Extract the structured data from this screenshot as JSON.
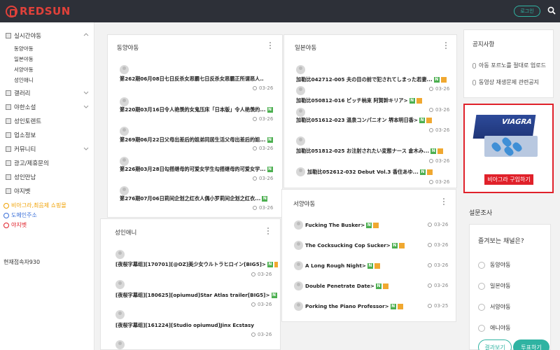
{
  "header": {
    "logo_text": "REDSUN",
    "login_label": "로그인",
    "accent": "#e0413a",
    "login_color": "#2fb3a2"
  },
  "sidebar": {
    "items": [
      {
        "label": "실시간야동",
        "expanded": true
      },
      {
        "label": "갤러리"
      },
      {
        "label": "야한소설"
      },
      {
        "label": "성인토렌트"
      },
      {
        "label": "업소정보"
      },
      {
        "label": "커뮤니티"
      },
      {
        "label": "광고/제휴문의"
      },
      {
        "label": "성인만남"
      },
      {
        "label": "야지벳"
      }
    ],
    "subitems": [
      "동양야동",
      "일본야동",
      "서양야동",
      "성인애니"
    ],
    "links": [
      {
        "label": "비아그라,최음제 쇼핑몰",
        "color": "#f0a000"
      },
      {
        "label": "도메인주소",
        "color": "#3a6fd8"
      },
      {
        "label": "야지벳",
        "color": "#e0212a"
      }
    ],
    "visitors": "현재접속자930"
  },
  "panels": {
    "dongyang": {
      "title": "동양야동",
      "posts": [
        {
          "title": "第262期06月08日七日反杀女恶霸七日反杀女恶霸正所谓恶人...",
          "date": "03-26",
          "n": false
        },
        {
          "title": "第220期03月16日令人艳羡的女鬼压床「日本版」令人艳羡的...",
          "date": "03-26",
          "n": true
        },
        {
          "title": "第269期06月22日父母出差后的姐弟同居生活父母出差后的姐...",
          "date": "03-26",
          "n": true
        },
        {
          "title": "第226期03月28日勾搭继母的可爱女学生勾搭继母的可爱女学...",
          "date": "03-26",
          "n": true
        },
        {
          "title": "第276期07月06日莉间企划之红衣人偶小罗莉间企划之红衣...",
          "date": "03-26",
          "n": true
        }
      ]
    },
    "ilbon": {
      "title": "일본야동",
      "posts": [
        {
          "title": "加勒比042712-005 夫の目の前で犯されてしまった若妻...",
          "date": "03-26"
        },
        {
          "title": "加勒比050812-016 ピッチ枘束 阿賀幹キリア>",
          "date": "03-26"
        },
        {
          "title": "加勒比051612-023 温泉コンパニオン 堺本明日香>",
          "date": "03-26"
        },
        {
          "title": "加勒比051812-025 お注射されたい変態ナース 倉木み...",
          "date": "03-26"
        },
        {
          "title": "加勒比052612-032 Debut Vol.3 香住あゆ...",
          "date": "03-26"
        }
      ]
    },
    "seoyang": {
      "title": "서양야동",
      "posts": [
        {
          "title": "Fucking The Busker>",
          "date": "03-26"
        },
        {
          "title": "The Cocksucking Cop Sucker>",
          "date": "03-26"
        },
        {
          "title": "A Long Rough Night>",
          "date": "03-26"
        },
        {
          "title": "Double Penetrate Date>",
          "date": "03-26"
        },
        {
          "title": "Porking the Piano Professor>",
          "date": "03-25"
        }
      ]
    },
    "anime": {
      "title": "성인애니",
      "posts": [
        {
          "title": "[夜桜字幕组][170701][@OZ]美少女ウルトラヒロイン[BIG5]>",
          "date": "03-26"
        },
        {
          "title": "[夜桜字幕组][180625][opiumud]Star Atlas trailer[BIG5]>",
          "date": "03-26"
        },
        {
          "title": "[夜桜字幕组][161224][Studio opiumud]Jinx Ecstasy",
          "date": "03-26"
        }
      ]
    }
  },
  "notice": {
    "title": "공지사항",
    "items": [
      "아동 포르노를 절대로 업로드",
      "동영상 재생문제 관련공지"
    ]
  },
  "ad": {
    "brand": "VIAGRA",
    "button_label": "비아그라 구입하기"
  },
  "survey": {
    "title": "설문조사",
    "question": "즐겨보는 채널은?",
    "options": [
      "동양야동",
      "일본야동",
      "서양야동",
      "애니야동"
    ],
    "result_label": "결과보기",
    "vote_label": "투표하기"
  }
}
